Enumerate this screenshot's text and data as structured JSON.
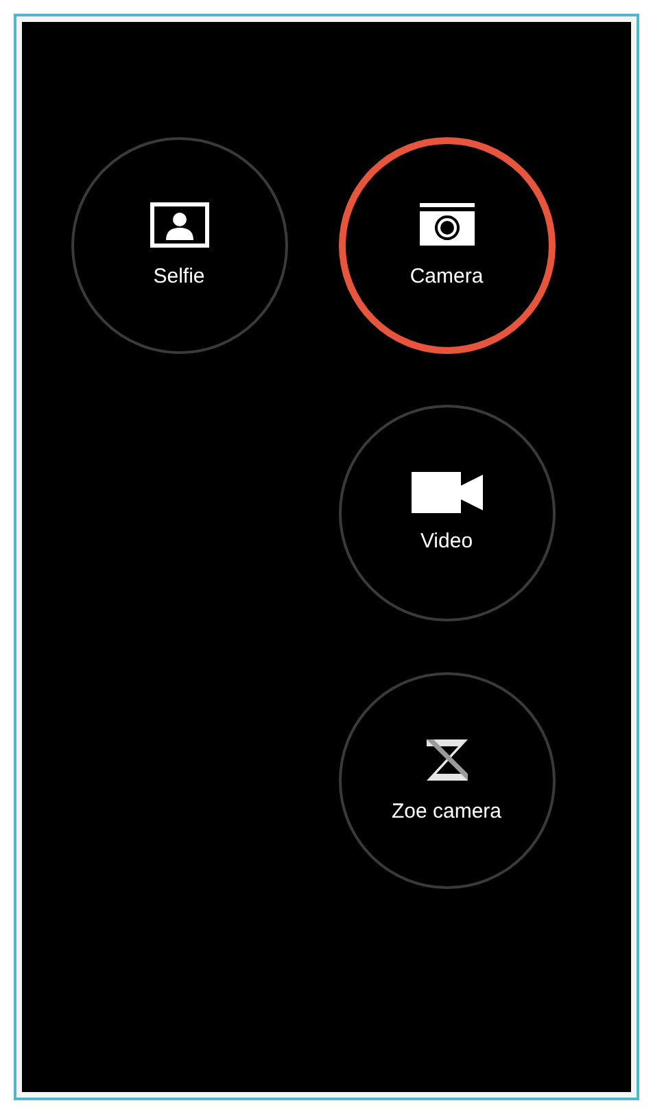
{
  "modes": [
    {
      "kind": "selfie",
      "label": "Selfie",
      "selected": false
    },
    {
      "kind": "camera",
      "label": "Camera",
      "selected": true
    },
    {
      "kind": "video",
      "label": "Video",
      "selected": false
    },
    {
      "kind": "zoe",
      "label": "Zoe camera",
      "selected": false
    }
  ]
}
